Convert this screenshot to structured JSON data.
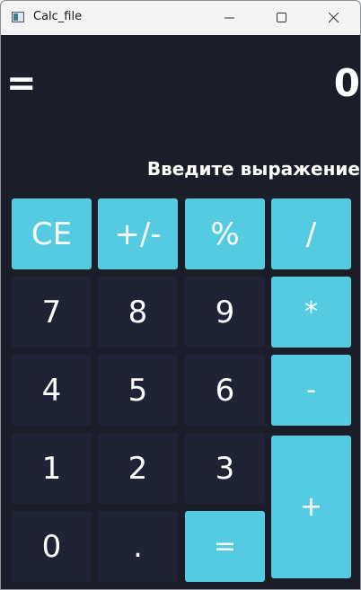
{
  "window": {
    "title": "Calc_file"
  },
  "icons": {
    "app": "app-icon",
    "minimize": "minimize-icon",
    "maximize": "maximize-icon",
    "close": "close-icon"
  },
  "display": {
    "equals_sign": "=",
    "result": "0",
    "expression": "Введите выражение"
  },
  "keys": {
    "ce": "CE",
    "plus_minus": "+/-",
    "percent": "%",
    "divide": "/",
    "seven": "7",
    "eight": "8",
    "nine": "9",
    "multiply": "*",
    "four": "4",
    "five": "5",
    "six": "6",
    "minus": "-",
    "one": "1",
    "two": "2",
    "three": "3",
    "plus": "+",
    "zero": "0",
    "dot": ".",
    "equals": "="
  },
  "colors": {
    "background": "#1b1e29",
    "accent_key": "#54cbe0",
    "dark_key": "#1f2335",
    "text": "#ffffff"
  }
}
